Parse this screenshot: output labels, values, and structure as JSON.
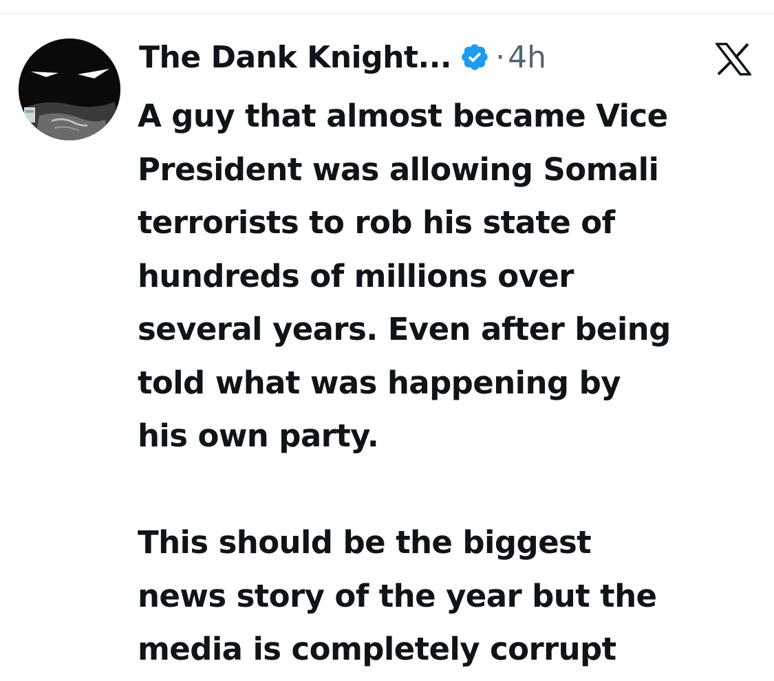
{
  "tweet": {
    "display_name": "The Dank Knight...",
    "separator": "·",
    "time": "4h",
    "paragraphs": [
      "A guy that almost became Vice\nPresident was allowing Somali\nterrorists to rob his state of\nhundreds of millions over\nseveral years. Even after being\ntold what was happening by\nhis own party.",
      "This should be the biggest\nnews story of the year but the\nmedia is completely corrupt"
    ]
  },
  "icons": {
    "avatar": "batman-comic-avatar",
    "verified": "verified-badge-icon",
    "brand": "x-logo-icon"
  },
  "colors": {
    "text": "#0f1419",
    "muted": "#536471",
    "verified": "#1d9bf0",
    "divider": "#e6e8ea",
    "background": "#ffffff"
  }
}
